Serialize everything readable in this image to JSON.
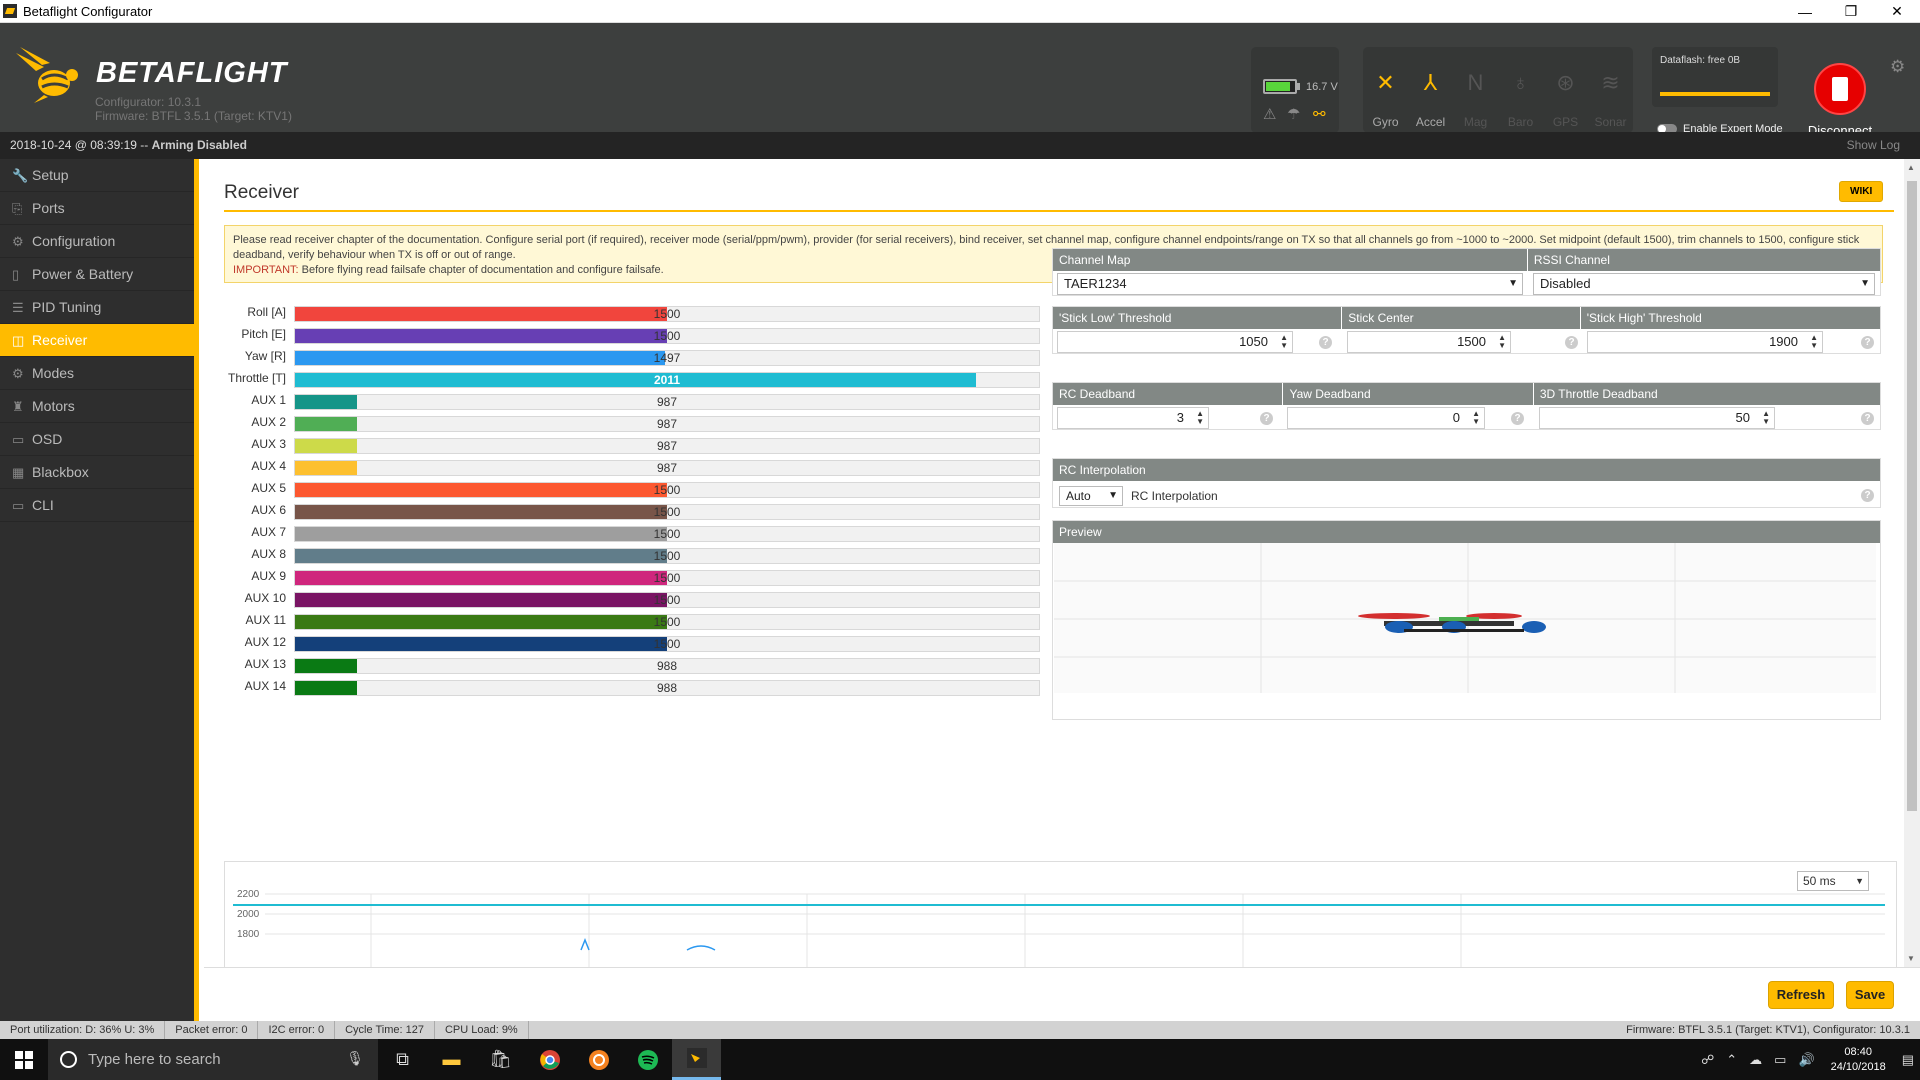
{
  "window": {
    "title": "Betaflight Configurator",
    "controls": [
      "—",
      "❐",
      "✕"
    ]
  },
  "header": {
    "brand": "BETAFLIGHT",
    "configurator_version": "Configurator: 10.3.1",
    "firmware": "Firmware: BTFL 3.5.1 (Target: KTV1)",
    "voltage": "16.7 V",
    "battery_level": 0.85,
    "sensors": [
      {
        "label": "Gyro",
        "icon": "gyro-icon",
        "active": true
      },
      {
        "label": "Accel",
        "icon": "accel-icon",
        "active": true
      },
      {
        "label": "Mag",
        "icon": "mag-icon",
        "active": false
      },
      {
        "label": "Baro",
        "icon": "baro-icon",
        "active": false
      },
      {
        "label": "GPS",
        "icon": "gps-icon",
        "active": false
      },
      {
        "label": "Sonar",
        "icon": "sonar-icon",
        "active": false
      }
    ],
    "dataflash": "Dataflash: free 0B",
    "expert_mode": "Enable Expert Mode",
    "disconnect": "Disconnect"
  },
  "logbar": {
    "datetime": "2018-10-24 @ 08:39:19 -- ",
    "status": "Arming Disabled",
    "show_log": "Show Log"
  },
  "sidebar": {
    "items": [
      {
        "label": "Setup",
        "icon": "wrench-icon"
      },
      {
        "label": "Ports",
        "icon": "ports-icon"
      },
      {
        "label": "Configuration",
        "icon": "gear-icon"
      },
      {
        "label": "Power & Battery",
        "icon": "battery-icon"
      },
      {
        "label": "PID Tuning",
        "icon": "sliders-icon"
      },
      {
        "label": "Receiver",
        "icon": "receiver-icon",
        "active": true
      },
      {
        "label": "Modes",
        "icon": "modes-icon"
      },
      {
        "label": "Motors",
        "icon": "motor-icon"
      },
      {
        "label": "OSD",
        "icon": "osd-icon"
      },
      {
        "label": "Blackbox",
        "icon": "blackbox-icon"
      },
      {
        "label": "CLI",
        "icon": "cli-icon"
      }
    ]
  },
  "receiver": {
    "title": "Receiver",
    "wiki": "WIKI",
    "note": "Please read receiver chapter of the documentation. Configure serial port (if required), receiver mode (serial/ppm/pwm), provider (for serial receivers), bind receiver, set channel map, configure channel endpoints/range on TX so that all channels go from ~1000 to ~2000. Set midpoint (default 1500), trim channels to 1500, configure stick deadband, verify behaviour when TX is off or out of range.",
    "important_label": "IMPORTANT:",
    "important_text": " Before flying read failsafe chapter of documentation and configure failsafe.",
    "channels": [
      {
        "label": "Roll [A]",
        "value": 1500,
        "color": "#f1453d"
      },
      {
        "label": "Pitch [E]",
        "value": 1500,
        "color": "#673fb4"
      },
      {
        "label": "Yaw [R]",
        "value": 1497,
        "color": "#2b98f0"
      },
      {
        "label": "Throttle [T]",
        "value": 2011,
        "color": "#1fbcd2"
      },
      {
        "label": "AUX 1",
        "value": 987,
        "color": "#159588"
      },
      {
        "label": "AUX 2",
        "value": 987,
        "color": "#50ae55"
      },
      {
        "label": "AUX 3",
        "value": 987,
        "color": "#cdda49"
      },
      {
        "label": "AUX 4",
        "value": 987,
        "color": "#fdc02f"
      },
      {
        "label": "AUX 5",
        "value": 1500,
        "color": "#fc5830"
      },
      {
        "label": "AUX 6",
        "value": 1500,
        "color": "#785549"
      },
      {
        "label": "AUX 7",
        "value": 1500,
        "color": "#9e9e9e"
      },
      {
        "label": "AUX 8",
        "value": 1500,
        "color": "#617d8a"
      },
      {
        "label": "AUX 9",
        "value": 1500,
        "color": "#cf267d"
      },
      {
        "label": "AUX 10",
        "value": 1500,
        "color": "#7a1464"
      },
      {
        "label": "AUX 11",
        "value": 1500,
        "color": "#3a7a14"
      },
      {
        "label": "AUX 12",
        "value": 1500,
        "color": "#14407a"
      },
      {
        "label": "AUX 13",
        "value": 988,
        "color": "#0a7a14"
      },
      {
        "label": "AUX 14",
        "value": 988,
        "color": "#0a7a14"
      }
    ],
    "channel_range": [
      885,
      2115
    ],
    "channel_map": {
      "label": "Channel Map",
      "value": "TAER1234"
    },
    "rssi": {
      "label": "RSSI Channel",
      "value": "Disabled"
    },
    "stick_low": {
      "label": "'Stick Low' Threshold",
      "value": "1050"
    },
    "stick_center": {
      "label": "Stick Center",
      "value": "1500"
    },
    "stick_high": {
      "label": "'Stick High' Threshold",
      "value": "1900"
    },
    "rc_deadband": {
      "label": "RC Deadband",
      "value": "3"
    },
    "yaw_deadband": {
      "label": "Yaw Deadband",
      "value": "0"
    },
    "throttle_deadband": {
      "label": "3D Throttle Deadband",
      "value": "50"
    },
    "rc_interpolation": {
      "label": "RC Interpolation",
      "value": "Auto",
      "desc": "RC Interpolation"
    },
    "preview": {
      "label": "Preview"
    },
    "graph": {
      "interval": "50 ms",
      "y_ticks": [
        "2200",
        "2000",
        "1800"
      ]
    }
  },
  "toolbar": {
    "refresh": "Refresh",
    "save": "Save"
  },
  "statusbar": {
    "port": "Port utilization: D: 36% U: 3%",
    "packet": "Packet error: 0",
    "i2c": "I2C error: 0",
    "cycle": "Cycle Time: 127",
    "cpu": "CPU Load: 9%",
    "right": "Firmware: BTFL 3.5.1 (Target: KTV1), Configurator: 10.3.1"
  },
  "taskbar": {
    "search_placeholder": "Type here to search",
    "time": "08:40",
    "date": "24/10/2018"
  }
}
